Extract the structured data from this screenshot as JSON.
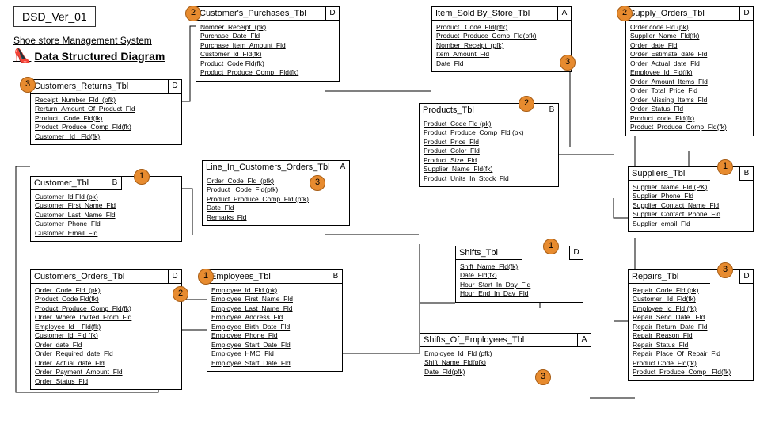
{
  "header": {
    "dsd_ver": "DSD_Ver_01",
    "title1": "Shoe store Management System",
    "title2": "Data Structured Diagram"
  },
  "tables": {
    "customers_returns": {
      "title": "Customers_Returns_Tbl",
      "corner": "D",
      "badge_left": "3",
      "fields": [
        "Receipt_Number_Fld_(pfk)",
        "Rerturn_Amount_Of_Product_Fld",
        "Product _Code_Fld(fk)",
        "Product_Produce_Comp_Fld(fk)",
        "Customer _Id _Fld(fk)"
      ]
    },
    "customer": {
      "title": "Customer_Tbl",
      "corner": "B",
      "badge": "1",
      "fields": [
        "Customer_Id Fld (pk)",
        "Customer_First_Name_Fld",
        "Customer_Last_Name_Fld",
        "Customer_Phone_Fld",
        "Customer_Email_Fld"
      ]
    },
    "customers_orders_hdr": {
      "title": "Customers_Orders_Tbl",
      "corner": "D",
      "badge": "2",
      "fields": [
        "Order_Code_Fld_(pk)",
        "Product_Code Fld(fk)",
        "Product_Produce_Comp_Fld(fk)",
        "Order_Where_Invited_From_Fld",
        "Employee_Id__Fld(fk)",
        "Customer_Id_Fld (fk)",
        "Order_date_Fld",
        "Order_Required_date_Fld",
        "Order_Actual_date_Fld",
        "Order_Payment_Amount_Fld",
        "Order_Status_Fld"
      ]
    },
    "customers_purchases": {
      "title": "Customer's_Purchases_Tbl",
      "corner": "D",
      "badge_left": "2",
      "fields": [
        "Nomber_Receipt_(pk)",
        "Purchase_Date_Fld",
        "Purchase_Item_Amount_Fld",
        "Customer_Id_Fld(fk)",
        "Product_Code Fld(fk)",
        "Product_Produce_Comp_ Fld(fk)"
      ]
    },
    "line_in_orders": {
      "title": "Line_In_Customers_Orders_Tbl",
      "corner": "A",
      "badge": "3",
      "fields": [
        "Order_Code_Fld_(pfk)",
        "Product_ Code_Fld(pfk)",
        "Product_Produce_Comp_Fld (pfk)",
        "Date_Fld",
        "Remarks_Fld"
      ]
    },
    "employees": {
      "title": "Employees_Tbl",
      "corner": "B",
      "badge_left": "1",
      "fields": [
        "Employee_Id_Fld (pk)",
        "Employee_First_Name_Fld",
        "Employee_Last_Name_Fld",
        "Employee_Address_Fld",
        "Employee_Birth_Date_Fld",
        "Employee_Phone_Fld",
        "Employee_Start_Date_Fld",
        "Employee_HMO_Fld",
        "Employee_Start_Date_Fld"
      ]
    },
    "item_sold": {
      "title": "Item_Sold By_Store_Tbl",
      "corner": "A",
      "badge": "3",
      "fields": [
        "Product _Code_Fld(pfk)",
        "Product_Produce_Comp_Fld(pfk)",
        "Nomber_Receipt_(pfk)",
        "Item_Amount_Fld",
        "Date_Fld"
      ]
    },
    "products": {
      "title": "Products_Tbl",
      "corner": "B",
      "badge": "2",
      "fields": [
        "Product_Code Fld (pk)",
        "Product_Produce_Comp_Fld (pk)",
        "Product_Price_Fld",
        "Product_Color_Fld",
        "Product_Size_Fld",
        "Supplier_Name_Fld(fk)",
        "Product_Units_In_Stock_Fld"
      ]
    },
    "shifts": {
      "title": "Shifts_Tbl",
      "corner": "D",
      "badge": "1",
      "fields": [
        "Shift_Name_Fld(fk)",
        "Date_Fld(fk)",
        "Hour_Start_In_Day_Fld",
        "Hour_End_In_Day_Fld"
      ]
    },
    "shifts_emp": {
      "title": "Shifts_Of_Employees_Tbl",
      "corner": "A",
      "badge": "3",
      "fields": [
        "Employee_Id_Fld (pfk)",
        "Shift_Name_Fld(pfk)",
        "Date_Fld(pfk)"
      ]
    },
    "supply_orders": {
      "title": "Supply_Orders_Tbl",
      "corner": "D",
      "badge_left": "2",
      "fields": [
        "Order code Fld (pk)",
        "Supplier_Name_Fld(fk)",
        "Order_date_Fld",
        "Order_Estimate_date_Fld",
        "Order_Actual_date_Fld",
        "Employee_Id_Fld(fk)",
        "Order_Amount_Items_Fld",
        "Order_Total_Price_Fld",
        "Order_Missing_Items_Fld",
        "Order_Status_Fld",
        "Product_code_Fld(fk)",
        "Product_Produce_Comp_Fld(fk)"
      ]
    },
    "suppliers": {
      "title": "Suppliers_Tbl",
      "corner": "B",
      "badge": "1",
      "fields": [
        "Supplier_Name_Fld (PK)",
        "Supplier_Phone_Fld",
        "Supplier_Contact_Name_Fld",
        "Supplier_Contact_Phone_Fld",
        "Supplier_email_Fld"
      ]
    },
    "repairs": {
      "title": "Repairs_Tbl",
      "corner": "D",
      "badge": "3",
      "fields": [
        "Repair_Code_Fld (pk)",
        "Customer _Id_Fld(fk)",
        "Employee_Id_Fld (fk)",
        "Repair_Send_Date _Fld",
        "Repair_Return_Date_Fld",
        "Repair_Reason_Fld",
        "Repair_Status_Fld",
        "Repair_Place_Of_Repair_Fld",
        "Product  Code_Fld(fk)",
        "Product_Produce_Comp_ Fld(fk)"
      ]
    }
  }
}
